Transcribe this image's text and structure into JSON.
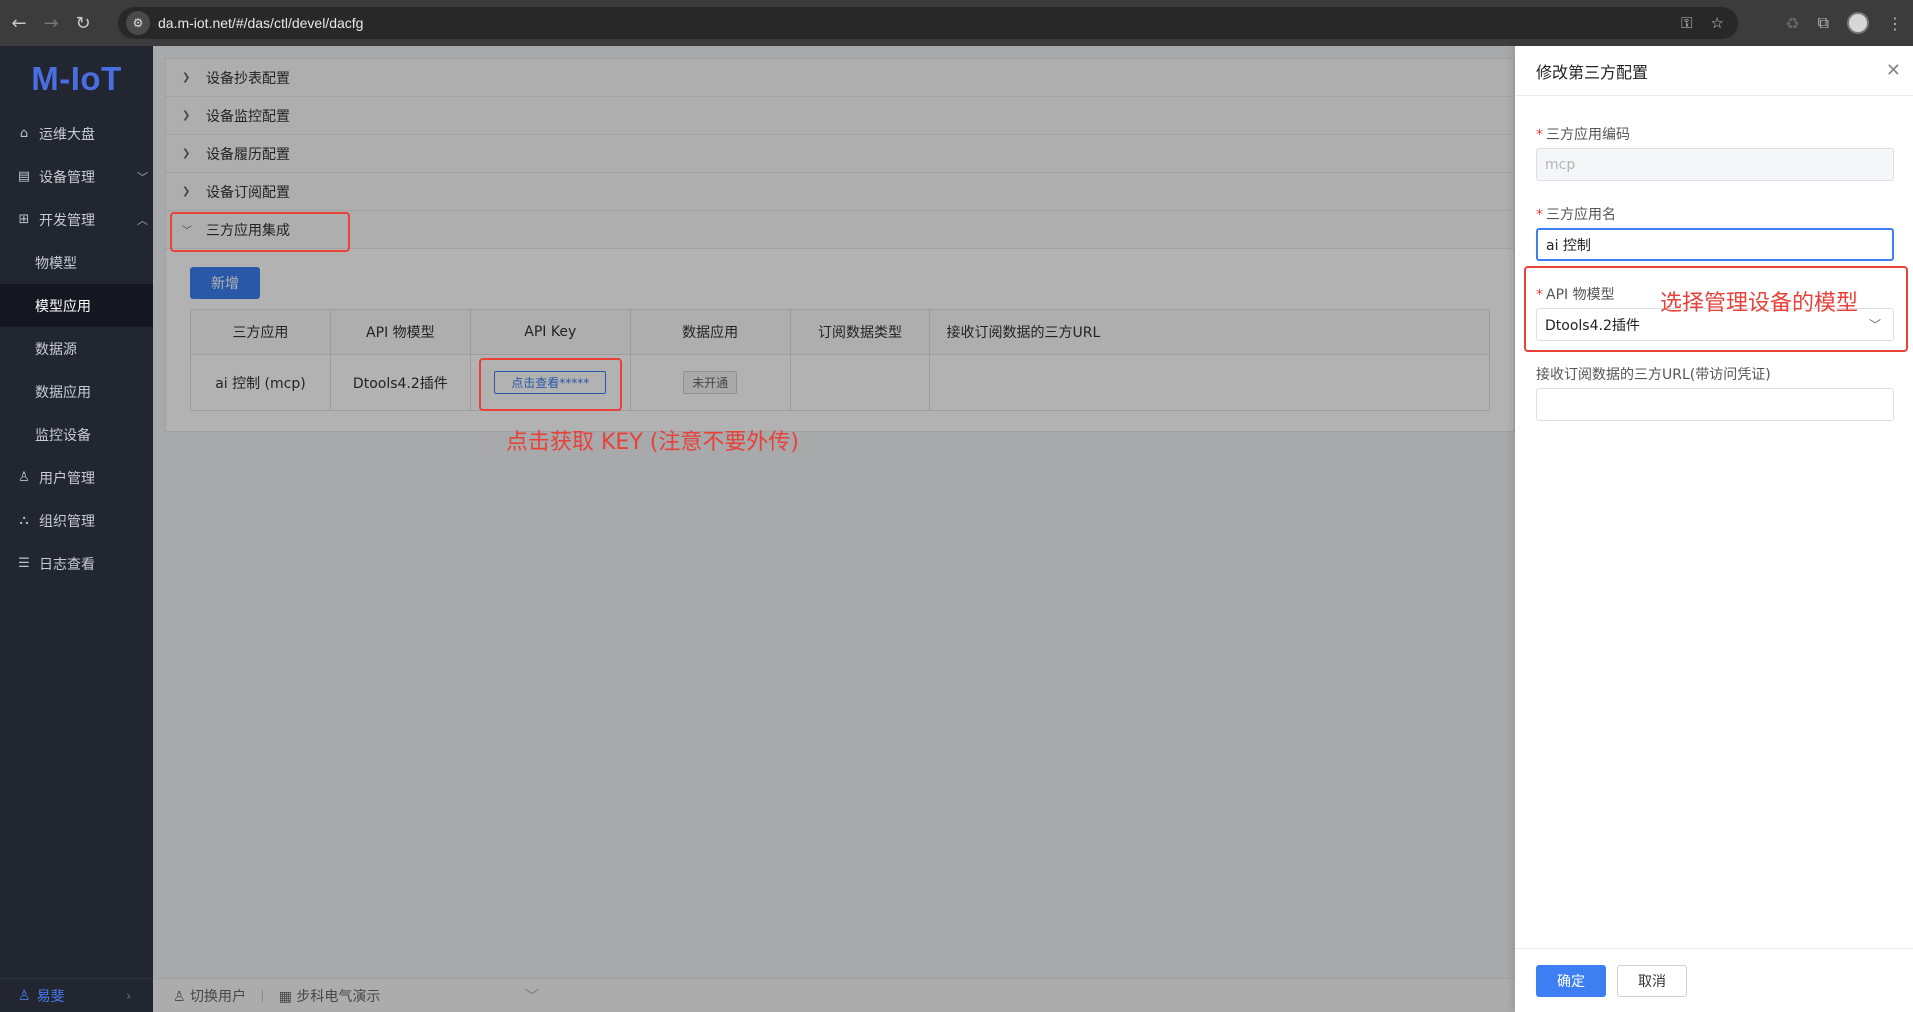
{
  "browser": {
    "url": "da.m-iot.net/#/das/ctl/devel/dacfg"
  },
  "sidebar": {
    "logo": "M-IoT",
    "items": [
      {
        "label": "运维大盘",
        "icon": "home-icon"
      },
      {
        "label": "设备管理",
        "icon": "device-icon"
      },
      {
        "label": "开发管理",
        "icon": "grid-icon"
      }
    ],
    "sub_items": [
      "物模型",
      "模型应用",
      "数据源",
      "数据应用",
      "监控设备"
    ],
    "more_items": [
      {
        "label": "用户管理",
        "icon": "user-icon"
      },
      {
        "label": "组织管理",
        "icon": "org-icon"
      },
      {
        "label": "日志查看",
        "icon": "list-icon"
      }
    ],
    "user": "易斐"
  },
  "main": {
    "sections": [
      "设备抄表配置",
      "设备监控配置",
      "设备履历配置",
      "设备订阅配置",
      "三方应用集成"
    ],
    "add_button": "新增",
    "table": {
      "headers": [
        "三方应用",
        "API 物模型",
        "API Key",
        "数据应用",
        "订阅数据类型",
        "接收订阅数据的三方URL"
      ],
      "row": {
        "app": "ai 控制 (mcp)",
        "model": "Dtools4.2插件",
        "key_button": "点击查看*****",
        "data_app": "未开通",
        "sub_type": "",
        "url": ""
      }
    },
    "bottom": {
      "switch_user": "切换用户",
      "org": "步科电气演示"
    }
  },
  "annotations": {
    "key_note": "点击获取 KEY (注意不要外传)",
    "model_note": "选择管理设备的模型"
  },
  "drawer": {
    "title": "修改第三方配置",
    "fields": {
      "code_label": "三方应用编码",
      "code_value": "mcp",
      "name_label": "三方应用名",
      "name_value": "ai 控制",
      "model_label": "API 物模型",
      "model_value": "Dtools4.2插件",
      "url_label": "接收订阅数据的三方URL(带访问凭证)",
      "url_value": ""
    },
    "ok": "确定",
    "cancel": "取消"
  },
  "colors": {
    "primary": "#3d7ff3",
    "annotation": "#e8413a",
    "sidebar_bg": "#222631"
  }
}
